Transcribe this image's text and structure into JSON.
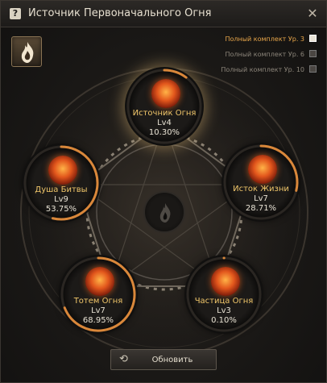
{
  "window": {
    "title": "Источник Первоначального Огня",
    "help_glyph": "?",
    "close_glyph": "✕"
  },
  "legend": [
    {
      "label": "Полный комплект Ур. 3",
      "checked": true
    },
    {
      "label": "Полный комплект Ур. 6",
      "checked": false
    },
    {
      "label": "Полный комплект Ур. 10",
      "checked": false
    }
  ],
  "nodes": [
    {
      "name": "Источник Огня",
      "level": "Lv4",
      "percent": "10.30%",
      "progress": 0.103,
      "highlighted": true,
      "icon": "fire-orb-icon"
    },
    {
      "name": "Душа Битвы",
      "level": "Lv9",
      "percent": "53.75%",
      "progress": 0.5375,
      "highlighted": false,
      "icon": "fire-warrior-icon"
    },
    {
      "name": "Исток Жизни",
      "level": "Lv7",
      "percent": "28.71%",
      "progress": 0.2871,
      "highlighted": false,
      "icon": "fire-phoenix-icon"
    },
    {
      "name": "Тотем Огня",
      "level": "Lv7",
      "percent": "68.95%",
      "progress": 0.6895,
      "highlighted": false,
      "icon": "fire-totem-icon"
    },
    {
      "name": "Частица Огня",
      "level": "Lv3",
      "percent": "0.10%",
      "progress": 0.001,
      "highlighted": false,
      "icon": "fire-particle-icon"
    }
  ],
  "refresh_button": {
    "label": "Обновить",
    "icon": "refresh-icon"
  },
  "colors": {
    "accent": "#e8a64a",
    "name_text": "#f0c66a",
    "progress_arc": "#d9873a"
  }
}
